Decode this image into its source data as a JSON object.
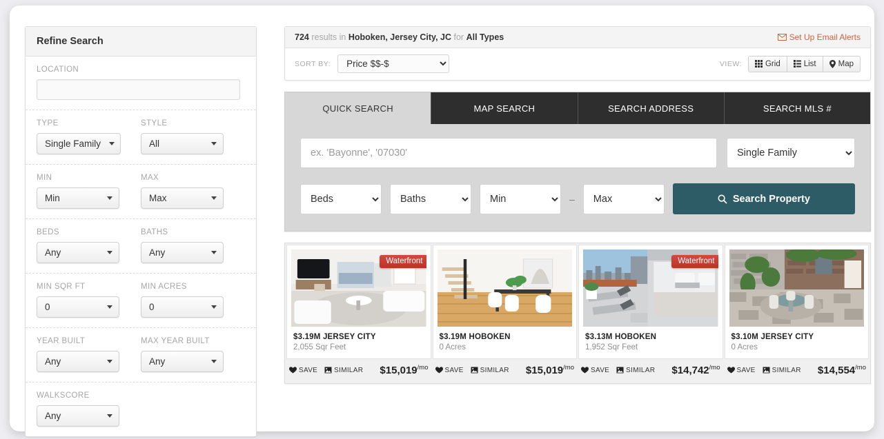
{
  "sidebar": {
    "title": "Refine Search",
    "rows": [
      {
        "fields": [
          {
            "label": "LOCATION",
            "type": "input",
            "value": ""
          }
        ]
      },
      {
        "fields": [
          {
            "label": "TYPE",
            "type": "select",
            "value": "Single Family"
          },
          {
            "label": "STYLE",
            "type": "select",
            "value": "All"
          }
        ]
      },
      {
        "fields": [
          {
            "label": "MIN",
            "type": "select",
            "value": "Min"
          },
          {
            "label": "MAX",
            "type": "select",
            "value": "Max"
          }
        ]
      },
      {
        "fields": [
          {
            "label": "BEDS",
            "type": "select",
            "value": "Any"
          },
          {
            "label": "BATHS",
            "type": "select",
            "value": "Any"
          }
        ]
      },
      {
        "fields": [
          {
            "label": "MIN SQR FT",
            "type": "select",
            "value": "0"
          },
          {
            "label": "MIN ACRES",
            "type": "select",
            "value": "0"
          }
        ]
      },
      {
        "fields": [
          {
            "label": "YEAR BUILT",
            "type": "select",
            "value": "Any"
          },
          {
            "label": "MAX YEAR BUILT",
            "type": "select",
            "value": "Any"
          }
        ]
      },
      {
        "fields": [
          {
            "label": "WALKSCORE",
            "type": "select",
            "value": "Any"
          }
        ]
      }
    ]
  },
  "results_bar": {
    "count": "724",
    "results_word": "results",
    "in_word": "in",
    "location": "Hoboken, Jersey City, JC",
    "for_word": "for",
    "types": "All Types",
    "email_alerts": "Set Up Email Alerts",
    "email_icon": "envelope-icon",
    "sort_label": "SORT BY:",
    "sort_value": "Price $$-$",
    "sort_options": [
      "Price $$-$"
    ],
    "view_label": "VIEW:",
    "views": [
      {
        "label": "Grid",
        "icon": "grid-icon",
        "active": true
      },
      {
        "label": "List",
        "icon": "list-icon",
        "active": false
      },
      {
        "label": "Map",
        "icon": "map-pin-icon",
        "active": false
      }
    ]
  },
  "search_panel": {
    "tabs": [
      {
        "label": "QUICK SEARCH",
        "active": true
      },
      {
        "label": "MAP SEARCH",
        "active": false
      },
      {
        "label": "SEARCH ADDRESS",
        "active": false
      },
      {
        "label": "SEARCH MLS #",
        "active": false
      }
    ],
    "location_placeholder": "ex. 'Bayonne', '07030'",
    "location_value": "",
    "type_value": "Single Family",
    "type_options": [
      "Single Family"
    ],
    "beds_value": "Beds",
    "baths_value": "Baths",
    "price_min_value": "Min",
    "price_max_value": "Max",
    "range_separator": "–",
    "search_button": "Search Property",
    "search_icon": "magnifier-icon"
  },
  "cards": [
    {
      "title": "$3.19M JERSEY CITY",
      "sub": "2,055 Sqr Feet",
      "badge": "Waterfront",
      "save": "SAVE",
      "similar": "SIMILAR",
      "price": "$15,019",
      "per": "/mo"
    },
    {
      "title": "$3.19M HOBOKEN",
      "sub": "0 Acres",
      "badge": "",
      "save": "SAVE",
      "similar": "SIMILAR",
      "price": "$15,019",
      "per": "/mo"
    },
    {
      "title": "$3.13M HOBOKEN",
      "sub": "1,952 Sqr Feet",
      "badge": "Waterfront",
      "save": "SAVE",
      "similar": "SIMILAR",
      "price": "$14,742",
      "per": "/mo"
    },
    {
      "title": "$3.10M JERSEY CITY",
      "sub": "0 Acres",
      "badge": "",
      "save": "SAVE",
      "similar": "SIMILAR",
      "price": "$14,554",
      "per": "/mo"
    }
  ],
  "colors": {
    "accent_link": "#d1603d",
    "search_button": "#2e5c66",
    "badge": "#c63a2e",
    "tab_inactive": "#2e2e2e"
  }
}
